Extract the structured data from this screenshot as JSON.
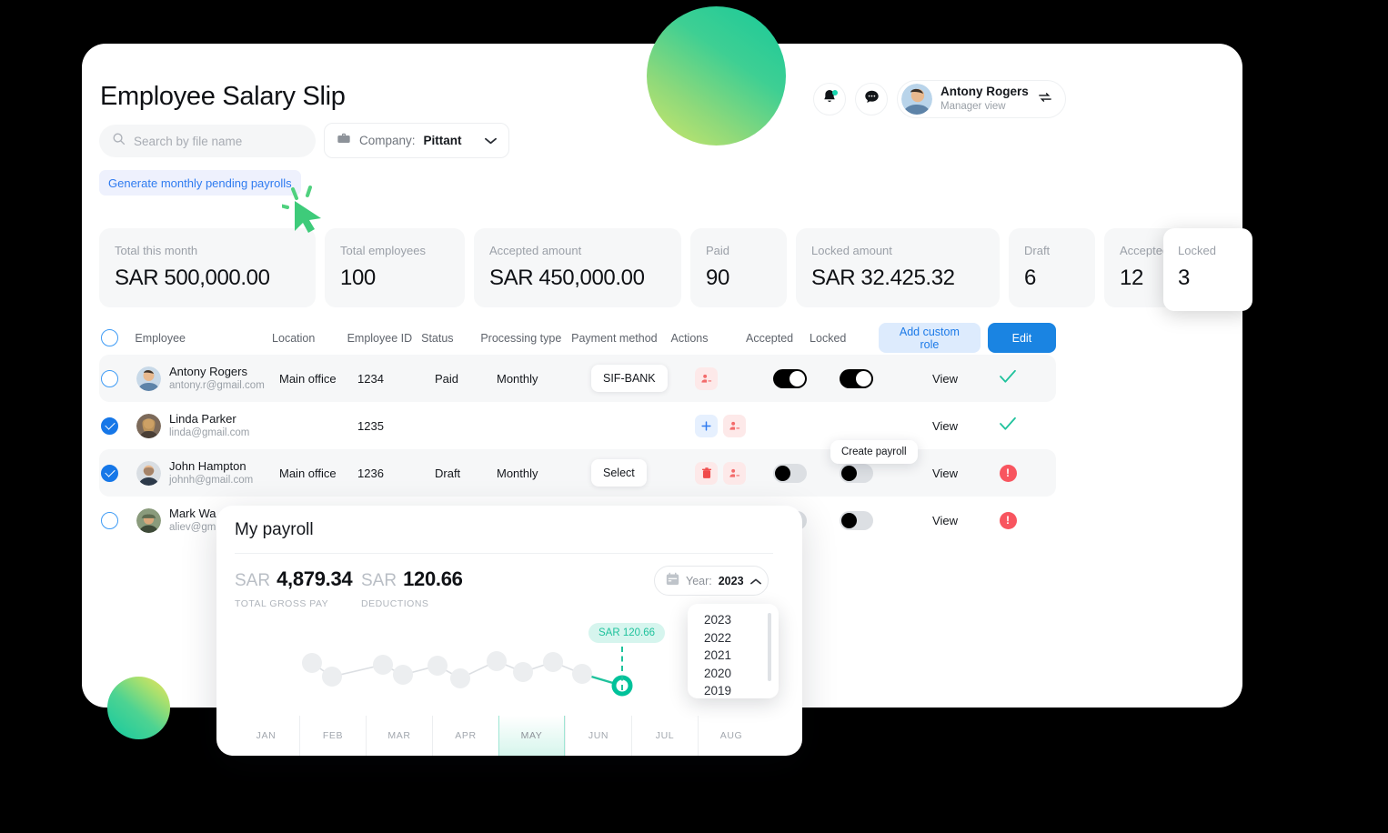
{
  "header": {
    "title": "Employee Salary Slip",
    "notifications_icon": "bell-icon",
    "messages_icon": "chat-icon",
    "user_name": "Antony Rogers",
    "user_role": "Manager view",
    "switch_icon": "swap-icon"
  },
  "search": {
    "placeholder": "Search by file name",
    "icon": "search-icon"
  },
  "company": {
    "icon": "briefcase-icon",
    "label": "Company:",
    "value": "Pittant",
    "chevron": "chevron-down-icon"
  },
  "generate_button": {
    "label": "Generate monthly pending payrolls"
  },
  "stats": [
    {
      "key": "Total this month",
      "value": "SAR 500,000.00"
    },
    {
      "key": "Total employees",
      "value": "100"
    },
    {
      "key": "Accepted amount",
      "value": "SAR 450,000.00"
    },
    {
      "key": "Paid",
      "value": "90"
    },
    {
      "key": "Locked amount",
      "value": "SAR 32.425.32"
    },
    {
      "key": "Draft",
      "value": "6"
    },
    {
      "key": "Accepted",
      "value": "12"
    }
  ],
  "stat_locked": {
    "key": "Locked",
    "value": "3"
  },
  "table": {
    "headers": {
      "employee": "Employee",
      "location": "Location",
      "employee_id": "Employee ID",
      "status": "Status",
      "processing_type": "Processing type",
      "payment_method": "Payment method",
      "actions": "Actions",
      "accepted": "Accepted",
      "locked": "Locked"
    },
    "add_custom_role": "Add custom role",
    "edit": "Edit",
    "view_label": "View",
    "rows": [
      {
        "name": "Antony Rogers",
        "email": "antony.r@gmail.com",
        "location": "Main office",
        "employee_id": "1234",
        "status": "Paid",
        "processing_type": "Monthly",
        "payment_method": "SIF-BANK",
        "actions": [
          "user-remove-icon"
        ],
        "accepted_toggle": "on",
        "locked_toggle": "on",
        "selected": false,
        "status_indicator": "check"
      },
      {
        "name": "Linda Parker",
        "email": "linda@gmail.com",
        "location": "",
        "employee_id": "1235",
        "status": "",
        "processing_type": "",
        "payment_method": "",
        "actions": [
          "plus-icon",
          "user-remove-icon"
        ],
        "accepted_toggle": "none",
        "locked_toggle": "none",
        "selected": true,
        "status_indicator": "check"
      },
      {
        "name": "John Hampton",
        "email": "johnh@gmail.com",
        "location": "Main office",
        "employee_id": "1236",
        "status": "Draft",
        "processing_type": "Monthly",
        "payment_method": "Select",
        "actions": [
          "trash-icon",
          "user-remove-icon"
        ],
        "accepted_toggle": "off",
        "locked_toggle": "off",
        "selected": true,
        "status_indicator": "error"
      },
      {
        "name": "Mark Wa",
        "email": "aliev@gm",
        "location": "",
        "employee_id": "",
        "status": "",
        "processing_type": "",
        "payment_method": "",
        "actions": [],
        "accepted_toggle": "off",
        "locked_toggle": "off",
        "selected": false,
        "status_indicator": "error"
      }
    ]
  },
  "tooltip": {
    "text": "Create payroll"
  },
  "payroll_panel": {
    "title": "My payroll",
    "gross": {
      "currency": "SAR",
      "amount": "4,879.34",
      "label": "TOTAL GROSS PAY"
    },
    "deductions": {
      "currency": "SAR",
      "amount": "120.66",
      "label": "DEDUCTIONS"
    },
    "year_selector": {
      "icon": "calendar-icon",
      "label": "Year:",
      "value": "2023",
      "chevron": "chevron-up-icon"
    },
    "year_options": [
      "2023",
      "2022",
      "2021",
      "2020",
      "2019"
    ],
    "tooltip_value": "SAR 120.66",
    "active_month": "MAY"
  },
  "chart_data": {
    "type": "line",
    "title": "My payroll",
    "categories": [
      "JAN",
      "FEB",
      "MAR",
      "APR",
      "MAY",
      "JUN",
      "JUL",
      "AUG"
    ],
    "x": [
      1,
      2,
      3,
      4,
      5,
      6,
      7,
      8,
      9,
      10,
      11
    ],
    "values": [
      120,
      92,
      112,
      100,
      108,
      86,
      116,
      98,
      112,
      96,
      74
    ],
    "point_labels": [
      "",
      "",
      "",
      "",
      "",
      "",
      "",
      "",
      "",
      "",
      "SAR 120.66"
    ],
    "highlighted_index": 10,
    "highlight_label": "SAR 120.66",
    "xlabel": "",
    "ylabel": "",
    "grid": false,
    "legend": false,
    "accent_color": "#1fc29c",
    "point_color": "#e9eaec"
  },
  "colors": {
    "accent_teal": "#1fc29c",
    "primary_blue": "#1a84e2",
    "link_blue": "#3e9bf5",
    "danger_red": "#f8555f",
    "card_bg": "#f6f7f8"
  }
}
